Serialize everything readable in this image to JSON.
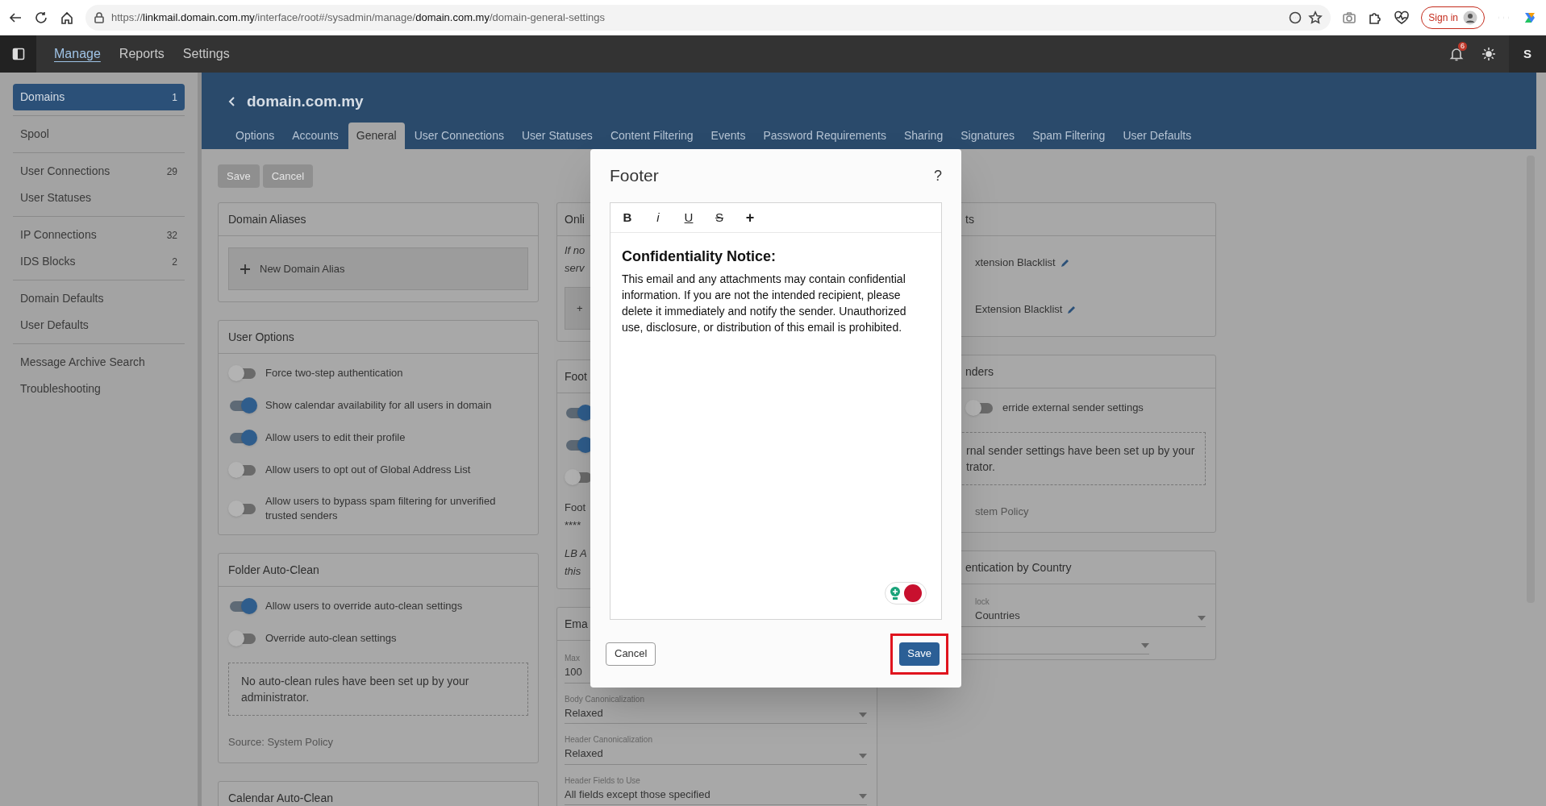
{
  "browser": {
    "url_parts": [
      {
        "text": "https://",
        "strong": false
      },
      {
        "text": "linkmail.domain.com.my",
        "strong": true
      },
      {
        "text": "/interface/root#/sysadmin/manage/",
        "strong": false
      },
      {
        "text": "domain.com.my",
        "strong": true
      },
      {
        "text": "/domain-general-settings",
        "strong": false
      }
    ],
    "sign_in": "Sign in"
  },
  "nav": {
    "items": [
      {
        "label": "Manage",
        "selected": true
      },
      {
        "label": "Reports",
        "selected": false
      },
      {
        "label": "Settings",
        "selected": false
      }
    ],
    "notification_count": "6",
    "avatar": "S"
  },
  "sidebar": {
    "groups": [
      [
        {
          "label": "Domains",
          "count": "1",
          "selected": true
        }
      ],
      [
        {
          "label": "Spool",
          "selected": false
        }
      ],
      [
        {
          "label": "User Connections",
          "count": "29",
          "selected": false
        },
        {
          "label": "User Statuses",
          "selected": false
        }
      ],
      [
        {
          "label": "IP Connections",
          "count": "32",
          "selected": false
        },
        {
          "label": "IDS Blocks",
          "count": "2",
          "selected": false
        }
      ],
      [
        {
          "label": "Domain Defaults",
          "selected": false
        },
        {
          "label": "User Defaults",
          "selected": false
        }
      ],
      [
        {
          "label": "Message Archive Search",
          "selected": false
        },
        {
          "label": "Troubleshooting",
          "selected": false
        }
      ]
    ]
  },
  "header": {
    "title": "domain.com.my",
    "tabs": [
      {
        "label": "Options",
        "selected": false
      },
      {
        "label": "Accounts",
        "selected": false
      },
      {
        "label": "General",
        "selected": true
      },
      {
        "label": "User Connections",
        "selected": false
      },
      {
        "label": "User Statuses",
        "selected": false
      },
      {
        "label": "Content Filtering",
        "selected": false
      },
      {
        "label": "Events",
        "selected": false
      },
      {
        "label": "Password Requirements",
        "selected": false
      },
      {
        "label": "Sharing",
        "selected": false
      },
      {
        "label": "Signatures",
        "selected": false
      },
      {
        "label": "Spam Filtering",
        "selected": false
      },
      {
        "label": "User Defaults",
        "selected": false
      }
    ]
  },
  "actions": [
    {
      "label": "Save",
      "disabled": true
    },
    {
      "label": "Cancel",
      "disabled": true
    }
  ],
  "columns": [
    [
      {
        "title": "Domain Aliases",
        "items": [
          {
            "kind": "add",
            "label": "New Domain Alias"
          }
        ]
      },
      {
        "title": "User Options",
        "items": [
          {
            "kind": "toggle",
            "label": "Force two-step authentication",
            "on": false
          },
          {
            "kind": "toggle",
            "label": "Show calendar availability for all users in domain",
            "on": true
          },
          {
            "kind": "toggle",
            "label": "Allow users to edit their profile",
            "on": true
          },
          {
            "kind": "toggle",
            "label": "Allow users to opt out of Global Address List",
            "on": false
          },
          {
            "kind": "toggle",
            "label": "Allow users to bypass spam filtering for unverified trusted senders",
            "on": false
          }
        ]
      },
      {
        "title": "Folder Auto-Clean",
        "items": [
          {
            "kind": "toggle",
            "label": "Allow users to override auto-clean settings",
            "on": true
          },
          {
            "kind": "toggle",
            "label": "Override auto-clean settings",
            "on": false
          },
          {
            "kind": "note",
            "text": "No auto-clean rules have been set up by your administrator."
          },
          {
            "kind": "source",
            "text": "Source: System Policy"
          }
        ]
      },
      {
        "title": "Calendar Auto-Clean"
      }
    ],
    [
      {
        "title": "Onli",
        "items": [
          {
            "kind": "text",
            "lines": [
              "If no",
              "serv"
            ],
            "italic": true
          },
          {
            "kind": "add",
            "label": "+"
          }
        ]
      },
      {
        "title": "Foot",
        "items": [
          {
            "kind": "toggle",
            "on": true
          },
          {
            "kind": "toggle",
            "on": true
          },
          {
            "kind": "toggle",
            "on": false
          },
          {
            "kind": "text",
            "lines": [
              "Foot",
              "****"
            ],
            "italic": false
          },
          {
            "kind": "text",
            "lines": [
              "LB A",
              "this"
            ],
            "italic": true
          }
        ]
      },
      {
        "title": "Ema",
        "items": [
          {
            "kind": "field",
            "label": "Max",
            "value": "100"
          },
          {
            "kind": "select",
            "label": "Body Canonicalization",
            "value": "Relaxed"
          },
          {
            "kind": "select",
            "label": "Header Canonicalization",
            "value": "Relaxed"
          },
          {
            "kind": "select",
            "label": "Header Fields to Use",
            "value": "All fields except those specified"
          }
        ]
      }
    ],
    [
      {
        "title": "ts",
        "items": [
          {
            "kind": "link",
            "text": "xtension Blacklist"
          },
          {
            "kind": "link",
            "text": "Extension Blacklist"
          }
        ]
      },
      {
        "title": "nders",
        "items": [
          {
            "kind": "toggle",
            "label": "erride external sender settings",
            "on": false
          },
          {
            "kind": "note",
            "text": "rnal sender settings have been set up by your\ntrator."
          },
          {
            "kind": "source",
            "text": "stem Policy"
          }
        ]
      },
      {
        "title": "entication by Country",
        "items": [
          {
            "kind": "select",
            "label": "lock",
            "value": "Countries"
          },
          {
            "kind": "select"
          }
        ]
      }
    ]
  ],
  "modal": {
    "title": "Footer",
    "help": "?",
    "format_buttons": [
      {
        "kind": "bold",
        "label": "B"
      },
      {
        "kind": "italic",
        "label": "i"
      },
      {
        "kind": "underline",
        "label": "U"
      },
      {
        "kind": "strike",
        "label": "S"
      },
      {
        "kind": "plus",
        "label": "+"
      }
    ],
    "heading": "Confidentiality Notice:",
    "body": "This email and any attachments may contain confidential information. If you are not the intended recipient, please delete it immediately and notify the sender. Unauthorized use, disclosure, or distribution of this email is prohibited.",
    "cancel": "Cancel",
    "save": "Save"
  }
}
